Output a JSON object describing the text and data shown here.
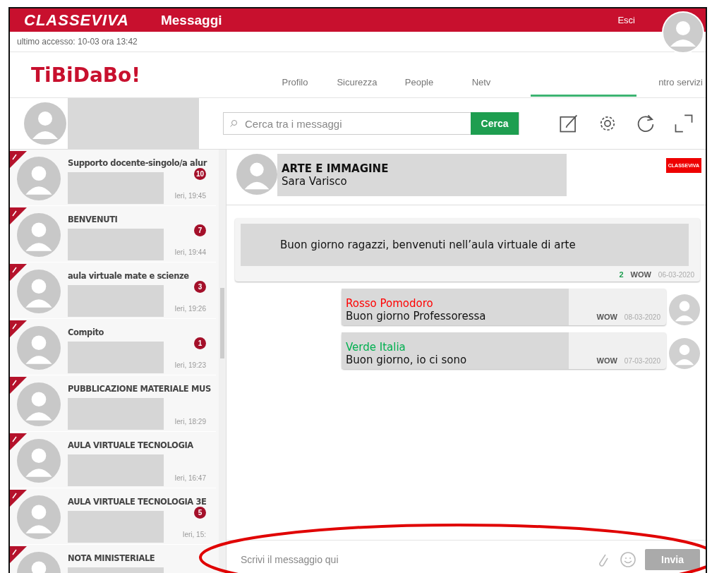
{
  "header": {
    "brand": "CLASSEVIVA",
    "title": "Messaggi",
    "logout": "Esci",
    "last_access": "ultimo accesso: 10-03 ora 13:42"
  },
  "nav": {
    "logo": "TiBiDaBo!",
    "tabs": [
      {
        "label": "Profilo"
      },
      {
        "label": "Sicurezza"
      },
      {
        "label": "People"
      },
      {
        "label": "Netv"
      },
      {
        "label": "ntro servizi"
      }
    ]
  },
  "search": {
    "placeholder": "Cerca tra i messaggi",
    "button": "Cerca"
  },
  "conversations": [
    {
      "title": "Supporto docente-singolo/a alur",
      "time": "Ieri, 19:45",
      "unread": "10"
    },
    {
      "title": "BENVENUTI",
      "time": "Ieri, 19:44",
      "unread": "7"
    },
    {
      "title": "aula virtuale mate e scienze",
      "time": "Ieri, 19:26",
      "unread": "3"
    },
    {
      "title": "Compito",
      "time": "Ieri, 19:23",
      "unread": "1"
    },
    {
      "title": "PUBBLICAZIONE MATERIALE MUS",
      "time": "Ieri, 18:29"
    },
    {
      "title": "AULA VIRTUALE TECNOLOGIA",
      "time": "Ieri, 16:47"
    },
    {
      "title": "AULA VIRTUALE TECNOLOGIA 3E",
      "time": "Ieri, 15:",
      "unread": "5"
    },
    {
      "title": "NOTA MINISTERIALE"
    }
  ],
  "chat": {
    "subject": "ARTE E IMMAGINE",
    "author": "Sara Varisco",
    "badge": "CLASSEVIVA",
    "messages": [
      {
        "kind": "teacher",
        "text": "Buon giorno ragazzi, benvenuti nell’aula virtuale di arte",
        "wow_count": "2",
        "wow": "WOW",
        "date": "06-03-2020"
      },
      {
        "kind": "student",
        "sender": "Rosso Pomodoro",
        "color": "#ff0000",
        "text": "Buon giorno Professoressa",
        "wow": "WOW",
        "date": "08-03-2020"
      },
      {
        "kind": "student",
        "sender": "Verde Italia",
        "color": "#00b050",
        "text": "Buon giorno, io ci sono",
        "wow": "WOW",
        "date": "07-03-2020"
      }
    ]
  },
  "composer": {
    "placeholder": "Scrivi il messaggio qui",
    "send": "Invia"
  }
}
